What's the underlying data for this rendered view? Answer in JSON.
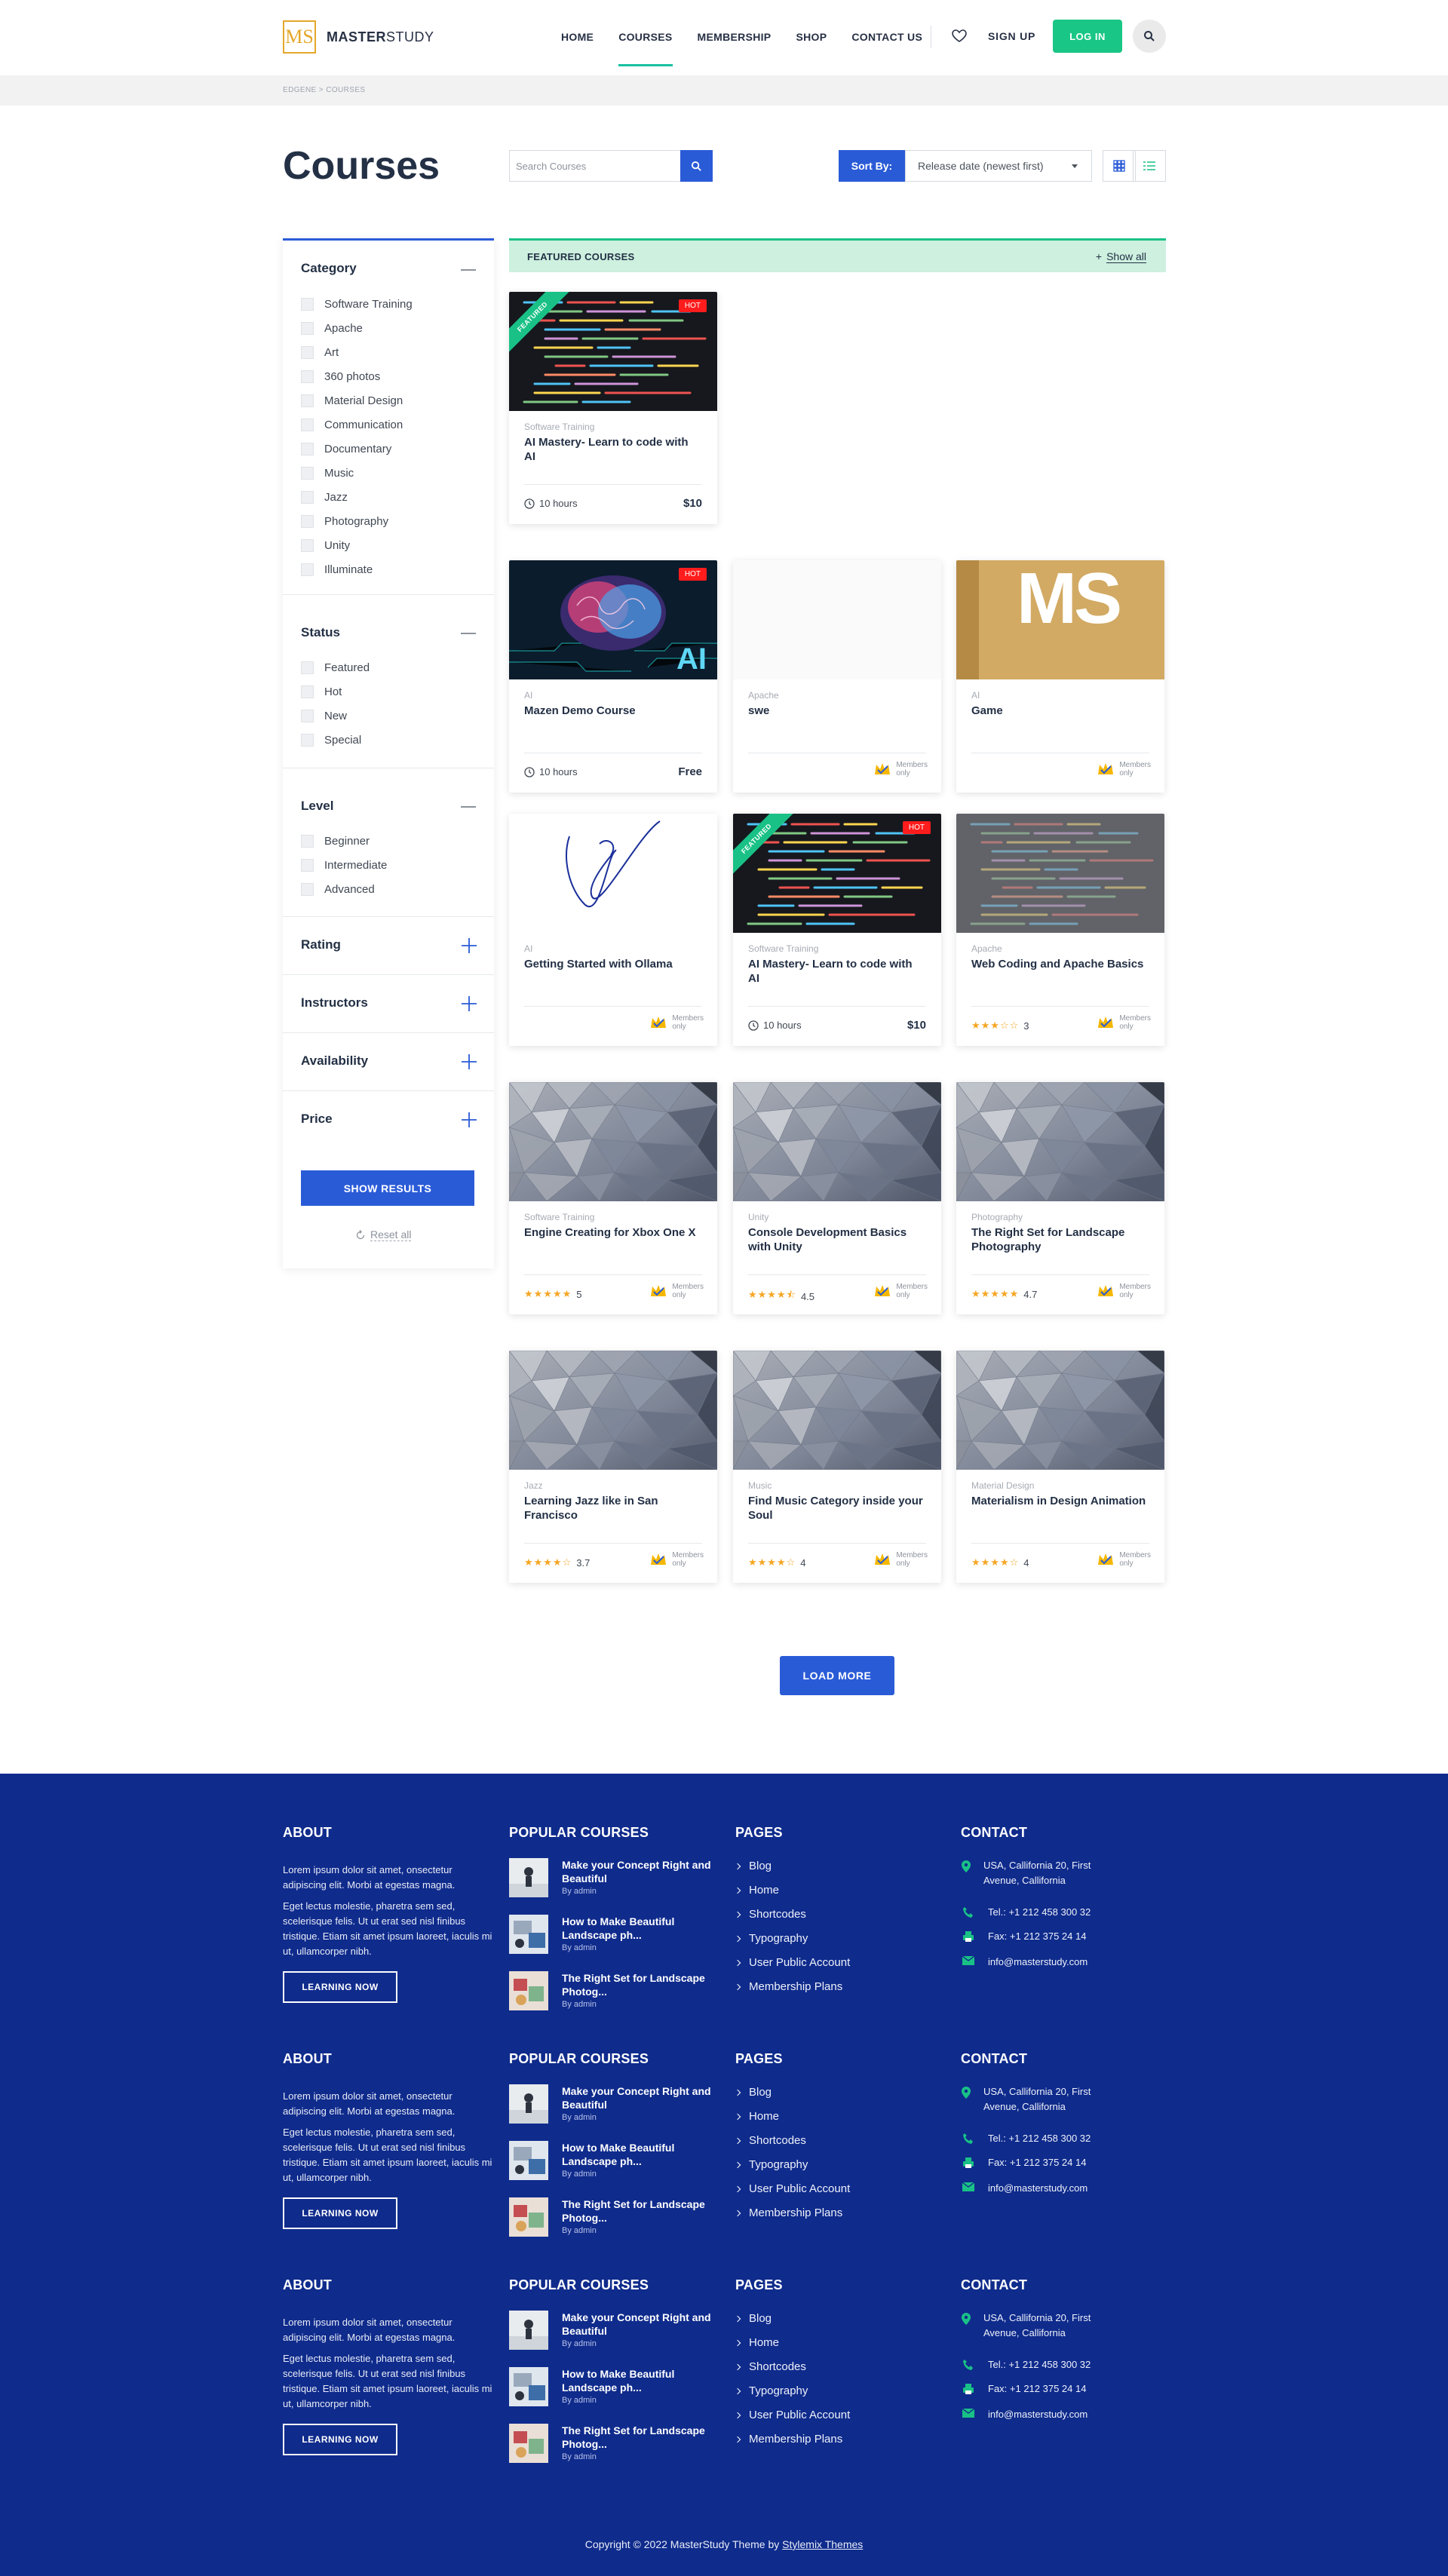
{
  "header": {
    "logo_mark": "MS",
    "logo_bold": "MASTER",
    "logo_light": "STUDY",
    "nav": [
      "HOME",
      "COURSES",
      "MEMBERSHIP",
      "SHOP",
      "CONTACT US"
    ],
    "active_nav": "COURSES",
    "signup": "SIGN UP",
    "login": "LOG IN"
  },
  "breadcrumb": "EDGENE > COURSES",
  "page": {
    "title": "Courses",
    "search_placeholder": "Search Courses",
    "sort_label": "Sort By:",
    "sort_value": "Release date (newest first)"
  },
  "filters": {
    "category": {
      "title": "Category",
      "items": [
        "Software Training",
        "Apache",
        "Art",
        "360 photos",
        "Material Design",
        "Communication",
        "Documentary",
        "Music",
        "Jazz",
        "Photography",
        "Unity",
        "Illuminate"
      ]
    },
    "status": {
      "title": "Status",
      "items": [
        "Featured",
        "Hot",
        "New",
        "Special"
      ]
    },
    "level": {
      "title": "Level",
      "items": [
        "Beginner",
        "Intermediate",
        "Advanced"
      ]
    },
    "collapsed": [
      "Rating",
      "Instructors",
      "Availability",
      "Price"
    ],
    "show_results": "SHOW RESULTS",
    "reset": "Reset all"
  },
  "featured": {
    "title": "FEATURED COURSES",
    "show_all": "Show all"
  },
  "labels": {
    "hot": "HOT",
    "featured": "FEATURED",
    "members_1": "Members",
    "members_2": "only"
  },
  "courses": [
    {
      "category": "Software Training",
      "title": "AI Mastery- Learn to code with AI",
      "duration": "10 hours",
      "price": "$10"
    },
    {
      "category": "AI",
      "title": "Mazen Demo Course",
      "duration": "10 hours",
      "price": "Free",
      "overlay": "AI"
    },
    {
      "category": "Apache",
      "title": "swe"
    },
    {
      "category": "AI",
      "title": "Game",
      "thumb_text": "MS"
    },
    {
      "category": "AI",
      "title": "Getting Started with Ollama"
    },
    {
      "category": "Software Training",
      "title": "AI Mastery- Learn to code with AI",
      "duration": "10 hours",
      "price": "$10"
    },
    {
      "category": "Apache",
      "title": "Web Coding and Apache Basics",
      "rating": "3",
      "stars": 3
    },
    {
      "category": "Software Training",
      "title": "Engine Creating for Xbox One X",
      "rating": "5",
      "stars": 5
    },
    {
      "category": "Unity",
      "title": "Console Development Basics with Unity",
      "rating": "4.5",
      "stars": 4.5
    },
    {
      "category": "Photography",
      "title": "The Right Set for Landscape Photography",
      "rating": "4.7",
      "stars": 5
    },
    {
      "category": "Jazz",
      "title": "Learning Jazz like in San Francisco",
      "rating": "3.7",
      "stars": 4
    },
    {
      "category": "Music",
      "title": "Find Music Category inside your Soul",
      "rating": "4",
      "stars": 4
    },
    {
      "category": "Material Design",
      "title": "Materialism in Design Animation",
      "rating": "4",
      "stars": 4
    }
  ],
  "load_more": "LOAD MORE",
  "footer": {
    "about": {
      "title": "ABOUT",
      "p1": "Lorem ipsum dolor sit amet, onsectetur adipiscing elit. Morbi at egestas magna.",
      "p2": "Eget lectus molestie, pharetra sem sed, scelerisque felis. Ut ut erat sed nisl finibus tristique. Etiam sit amet ipsum laoreet, iaculis mi ut, ullamcorper nibh.",
      "button": "LEARNING NOW"
    },
    "popular": {
      "title": "POPULAR COURSES",
      "items": [
        {
          "title": "Make your Concept Right and Beautiful",
          "by": "By admin"
        },
        {
          "title": "How to Make Beautiful Landscape ph...",
          "by": "By admin"
        },
        {
          "title": "The Right Set for Landscape Photog...",
          "by": "By admin"
        }
      ]
    },
    "pages": {
      "title": "PAGES",
      "items": [
        "Blog",
        "Home",
        "Shortcodes",
        "Typography",
        "User Public Account",
        "Membership Plans"
      ]
    },
    "contact": {
      "title": "CONTACT",
      "address": "USA, Callifornia 20, First Avenue, Callifornia",
      "tel": "Tel.: +1 212 458 300 32",
      "fax": "Fax: +1 212 375 24 14",
      "email": "info@masterstudy.com"
    },
    "copyright": "Copyright © 2022 MasterStudy Theme by",
    "copyright_link": "Stylemix Themes"
  },
  "colors": {
    "primary": "#2a5bd7",
    "green": "#19c186",
    "footer": "#0f2b8c",
    "hot": "#ff1c1c",
    "star": "#f5a623"
  }
}
